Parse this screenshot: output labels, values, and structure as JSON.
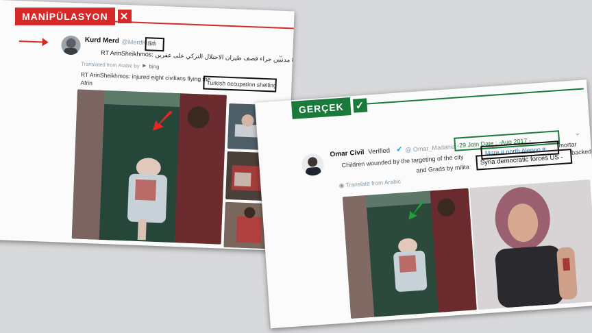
{
  "manipulation": {
    "tag_label": "MANİPÜLASYON",
    "tag_icon": "x-icon",
    "accent": "#d62828",
    "user_name": "Kurd Merd",
    "user_handle": "@MerdKurd",
    "time": "5m",
    "arabic_text": "RT ArinSheikhmos: اصابة 8 مدنيين جراء قصف طيران الاحتلال التركي على عفرين",
    "translated_from": "Translated from Arabic by",
    "translator": "bing",
    "translation_prefix": "RT ArinSheikhmos: injured eight civilians flying the",
    "translation_highlight": "Turkish occupation shelling",
    "translation_suffix": "Afrin"
  },
  "truth": {
    "tag_label": "GERÇEK",
    "tag_icon": "check-icon",
    "accent": "#1a7a3a",
    "user_name": "Omar Civil",
    "verified_label": "Verified",
    "user_handle": "@ Omar_Madania",
    "join_date": "-29 Join Date :  -Aug 2017 -",
    "line1_prefix": "Children wounded by the targeting of the city",
    "line1_link": "Mare # north Aleppo #",
    "line1_suffix": "mortar",
    "line2_prefix": "and Grads by milita",
    "line2_highlight": "Syria democratic forces US -",
    "line2_suffix": "backed",
    "translate_label": "Translate from Arabic"
  }
}
